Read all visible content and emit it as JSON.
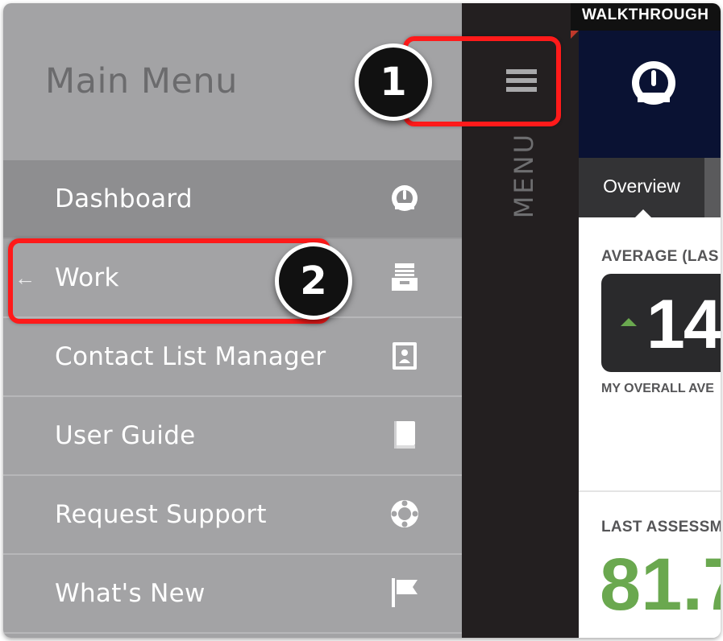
{
  "sidebar": {
    "title": "Main Menu",
    "items": [
      {
        "label": "Dashboard",
        "icon": "gauge-icon",
        "active": true
      },
      {
        "label": "Work",
        "icon": "inbox-tray-icon",
        "active": false,
        "back_arrow": "←"
      },
      {
        "label": "Contact List Manager",
        "icon": "contact-card-icon",
        "active": false
      },
      {
        "label": "User Guide",
        "icon": "book-icon",
        "active": false
      },
      {
        "label": "Request Support",
        "icon": "lifebuoy-icon",
        "active": false
      },
      {
        "label": "What's New",
        "icon": "flag-icon",
        "active": false
      }
    ]
  },
  "menu_tab": {
    "label": "MENU",
    "icon": "hamburger-icon"
  },
  "content": {
    "walkthrough_tag": "WALKTHROUGH",
    "logo_icon": "gauge-icon",
    "tabs": [
      {
        "label": "Overview"
      }
    ],
    "average_label": "AVERAGE (LAS",
    "average_value": "14",
    "average_trend": "up",
    "average_sub_label": "MY OVERALL AVE",
    "last_assessment_label": "LAST ASSESSM",
    "last_assessment_value": "81.7"
  },
  "annotations": [
    {
      "number": "1",
      "target": "hamburger-menu"
    },
    {
      "number": "2",
      "target": "Work"
    }
  ],
  "colors": {
    "sidebar_bg": "#a3a3a5",
    "sidebar_active_bg": "#8e8e90",
    "menu_tab_bg": "#231f20",
    "topbar_bg": "#0a1233",
    "callout_red": "#ff1a1a",
    "positive_green": "#6aa84f"
  }
}
